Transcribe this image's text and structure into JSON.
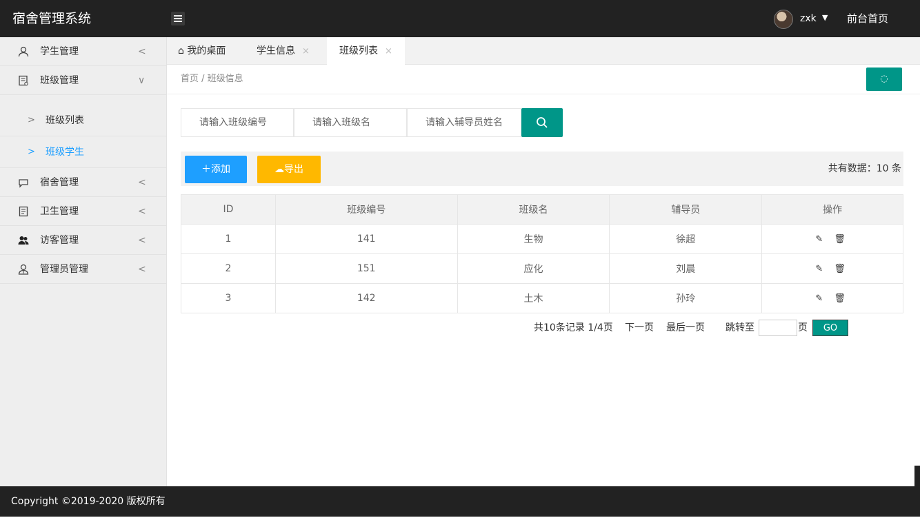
{
  "header": {
    "app_title": "宿舍管理系统",
    "user_name": "zxk",
    "user_caret": "▼",
    "front_link": "前台首页"
  },
  "sidebar": {
    "items": [
      {
        "label": "学生管理",
        "arrow": "<"
      },
      {
        "label": "班级管理",
        "arrow": "∨"
      },
      {
        "label": "宿舍管理",
        "arrow": "<"
      },
      {
        "label": "卫生管理",
        "arrow": "<"
      },
      {
        "label": "访客管理",
        "arrow": "<"
      },
      {
        "label": "管理员管理",
        "arrow": "<"
      }
    ],
    "sub_items": [
      {
        "label": "班级列表",
        "arrow": ">"
      },
      {
        "label": "班级学生",
        "arrow": ">"
      }
    ]
  },
  "tabs": [
    {
      "label": "我的桌面",
      "icon": "⌂"
    },
    {
      "label": "学生信息",
      "close": "×"
    },
    {
      "label": "班级列表",
      "close": "×"
    }
  ],
  "breadcrumb": "首页 / 班级信息",
  "refresh_label": "◌",
  "search": {
    "class_no_placeholder": "请输入班级编号",
    "class_name_placeholder": "请输入班级名",
    "counselor_placeholder": "请输入辅导员姓名"
  },
  "toolbar": {
    "add_label": "＋添加",
    "export_label": "☁导出",
    "total_text": "共有数据：10 条"
  },
  "table": {
    "headers": [
      "ID",
      "班级编号",
      "班级名",
      "辅导员",
      "操作"
    ],
    "rows": [
      {
        "id": "1",
        "class_no": "141",
        "class_name": "生物",
        "counselor": "徐超",
        "ops": "✎ 🗑"
      },
      {
        "id": "2",
        "class_no": "151",
        "class_name": "应化",
        "counselor": "刘晨",
        "ops": "✎ 🗑"
      },
      {
        "id": "3",
        "class_no": "142",
        "class_name": "土木",
        "counselor": "孙玲",
        "ops": "✎ 🗑"
      }
    ]
  },
  "pagination": {
    "summary": "共10条记录 1/4页",
    "next": "下一页",
    "last": "最后一页",
    "jump_to": "跳转至",
    "page_unit": "页",
    "go": "GO"
  },
  "footer": "Copyright ©2019-2020 版权所有"
}
